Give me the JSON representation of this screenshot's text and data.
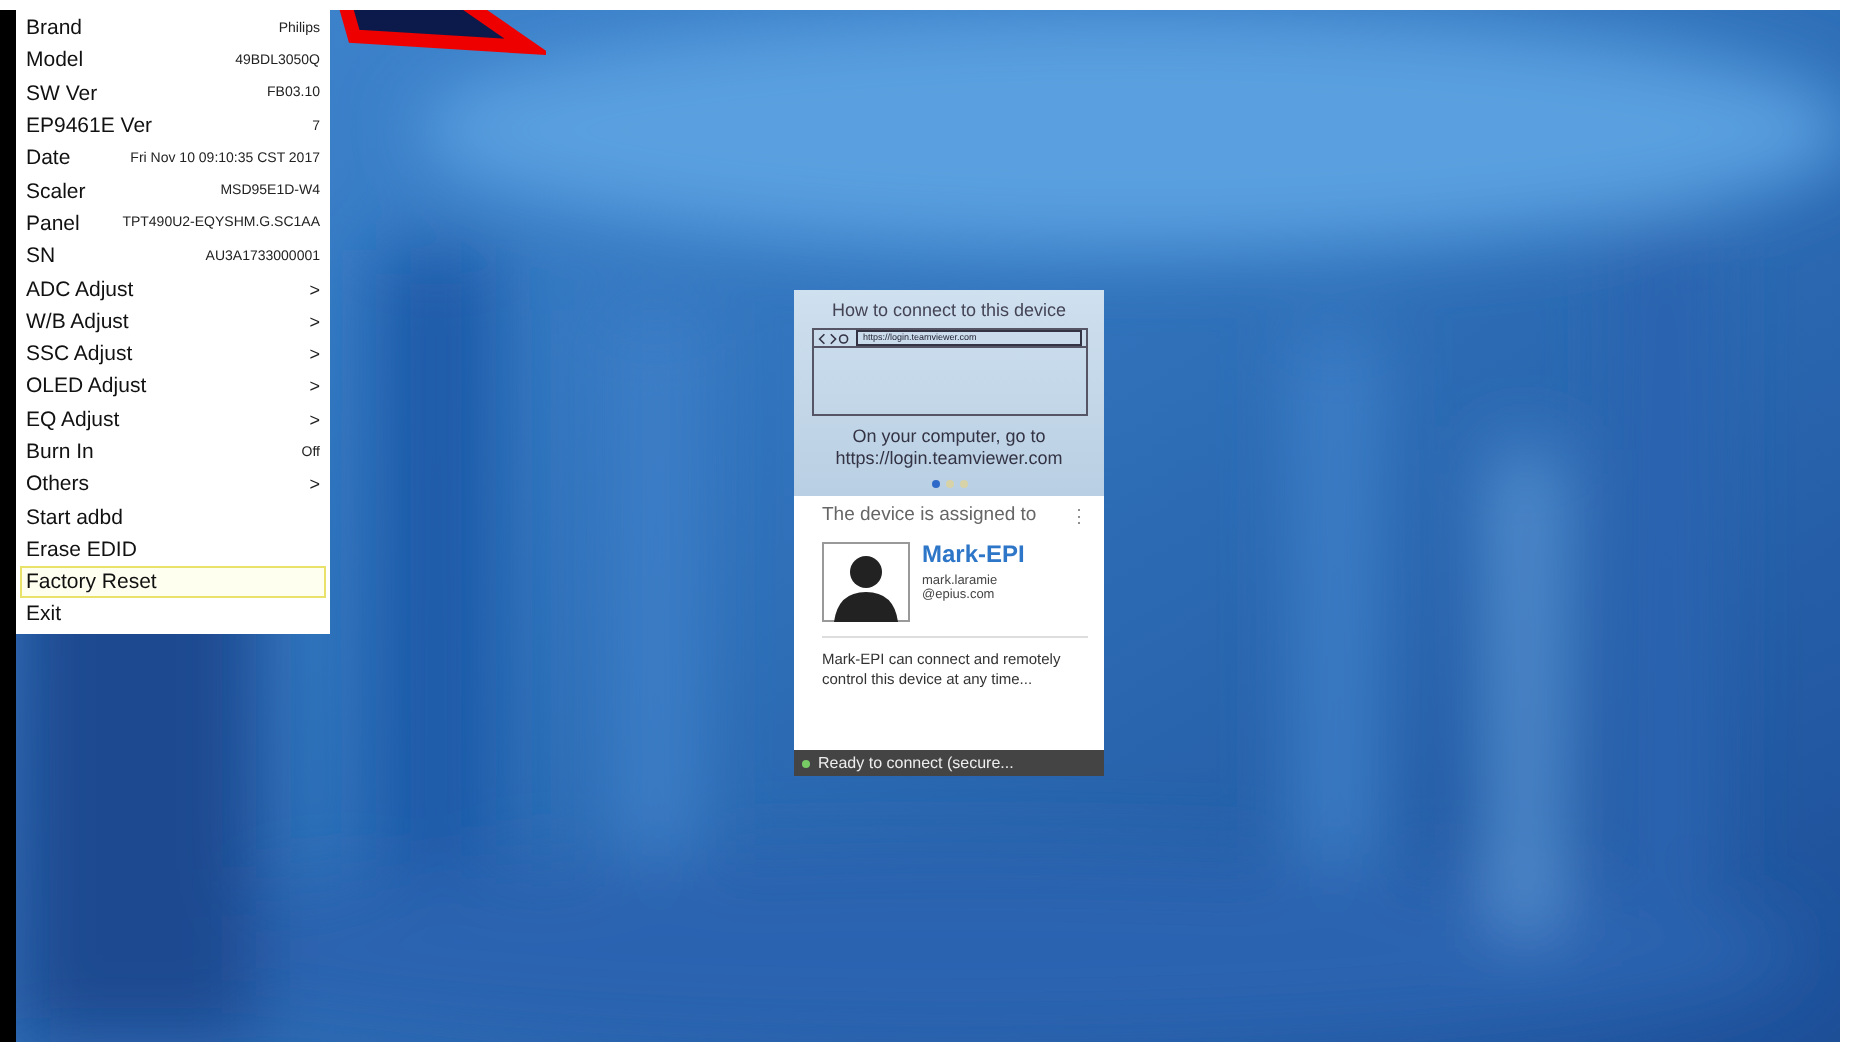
{
  "menu": {
    "items": [
      {
        "label": "Brand",
        "value": "Philips",
        "kind": "info",
        "selected": false
      },
      {
        "label": "Model",
        "value": "49BDL3050Q",
        "kind": "info",
        "selected": false
      },
      {
        "label": "SW Ver",
        "value": "FB03.10",
        "kind": "info",
        "selected": false
      },
      {
        "label": "EP9461E Ver",
        "value": "7",
        "kind": "info",
        "selected": false
      },
      {
        "label": "Date",
        "value": "Fri Nov 10 09:10:35 CST 2017",
        "kind": "info",
        "selected": false
      },
      {
        "label": "Scaler",
        "value": "MSD95E1D-W4",
        "kind": "info",
        "selected": false
      },
      {
        "label": "Panel",
        "value": "TPT490U2-EQYSHM.G.SC1AA",
        "kind": "info",
        "selected": false
      },
      {
        "label": "SN",
        "value": "AU3A1733000001",
        "kind": "info",
        "selected": false
      },
      {
        "label": "ADC Adjust",
        "value": ">",
        "kind": "submenu",
        "selected": false
      },
      {
        "label": "W/B Adjust",
        "value": ">",
        "kind": "submenu",
        "selected": false
      },
      {
        "label": "SSC Adjust",
        "value": ">",
        "kind": "submenu",
        "selected": false
      },
      {
        "label": "OLED Adjust",
        "value": ">",
        "kind": "submenu",
        "selected": false
      },
      {
        "label": "EQ Adjust",
        "value": ">",
        "kind": "submenu",
        "selected": false
      },
      {
        "label": "Burn In",
        "value": "Off",
        "kind": "info",
        "selected": false
      },
      {
        "label": "Others",
        "value": ">",
        "kind": "submenu",
        "selected": false
      },
      {
        "label": "Start adbd",
        "kind": "action",
        "selected": false
      },
      {
        "label": "Erase EDID",
        "kind": "action",
        "selected": false
      },
      {
        "label": "Factory Reset",
        "kind": "action",
        "selected": true
      },
      {
        "label": "Exit",
        "kind": "action",
        "selected": false
      }
    ]
  },
  "dialog": {
    "title": "How to connect to this device",
    "url": "https://login.teamviewer.com",
    "caption": "On your computer, go to https://login.teamviewer.com",
    "pager": [
      {
        "selected": true
      },
      {
        "selected": false
      },
      {
        "selected": false
      }
    ],
    "assigned_label": "The device is assigned to",
    "more": "⋮",
    "user_name": "Mark-EPI",
    "email_lines": [
      "mark.laramie",
      "@epius.com"
    ],
    "description": "Mark-EPI can connect and remotely control this device at any time...",
    "status": "Ready to connect (secure..."
  }
}
